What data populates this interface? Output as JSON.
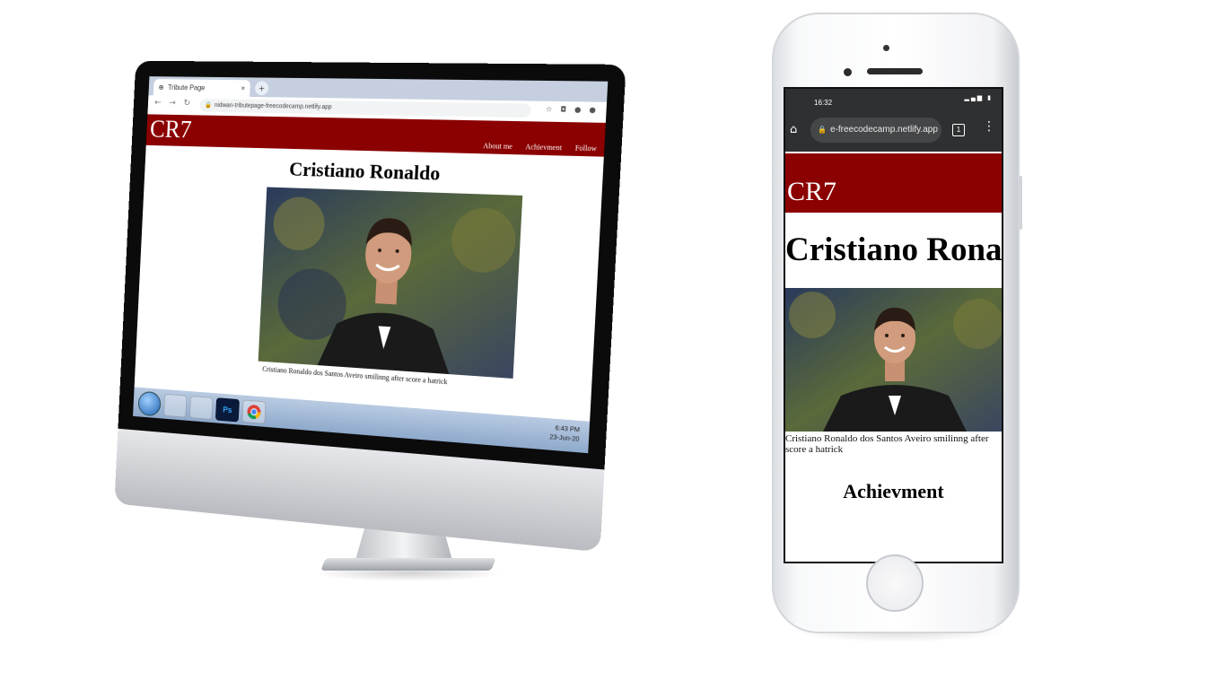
{
  "desktop": {
    "browser": {
      "tab_title": "Tribute Page",
      "tab_close": "×",
      "new_tab": "+",
      "back_icon": "←",
      "forward_icon": "→",
      "reload_icon": "↻",
      "url": "nidwan-tributepage-freecodecamp.netlify.app"
    },
    "site": {
      "logo": "CR7",
      "nav": [
        "About me",
        "Achievment",
        "Follow"
      ],
      "title": "Cristiano Ronaldo",
      "caption": "Cristiano Ronaldo dos Santos Aveiro smilinng after score a hatrick"
    },
    "taskbar": {
      "photoshop_label": "Ps",
      "clock_time": "6:43 PM",
      "clock_date": "23-Jun-20"
    }
  },
  "phone": {
    "status_time": "16:32",
    "url": "e-freecodecamp.netlify.app",
    "tab_count": "1",
    "site": {
      "logo": "CR7",
      "title": "Cristiano Ronaldo",
      "caption": "Cristiano Ronaldo dos Santos Aveiro smilinng after score a hatrick",
      "section_heading": "Achievment"
    }
  },
  "colors": {
    "header_red": "#8b0000",
    "chrome_dark": "#2f3031"
  }
}
